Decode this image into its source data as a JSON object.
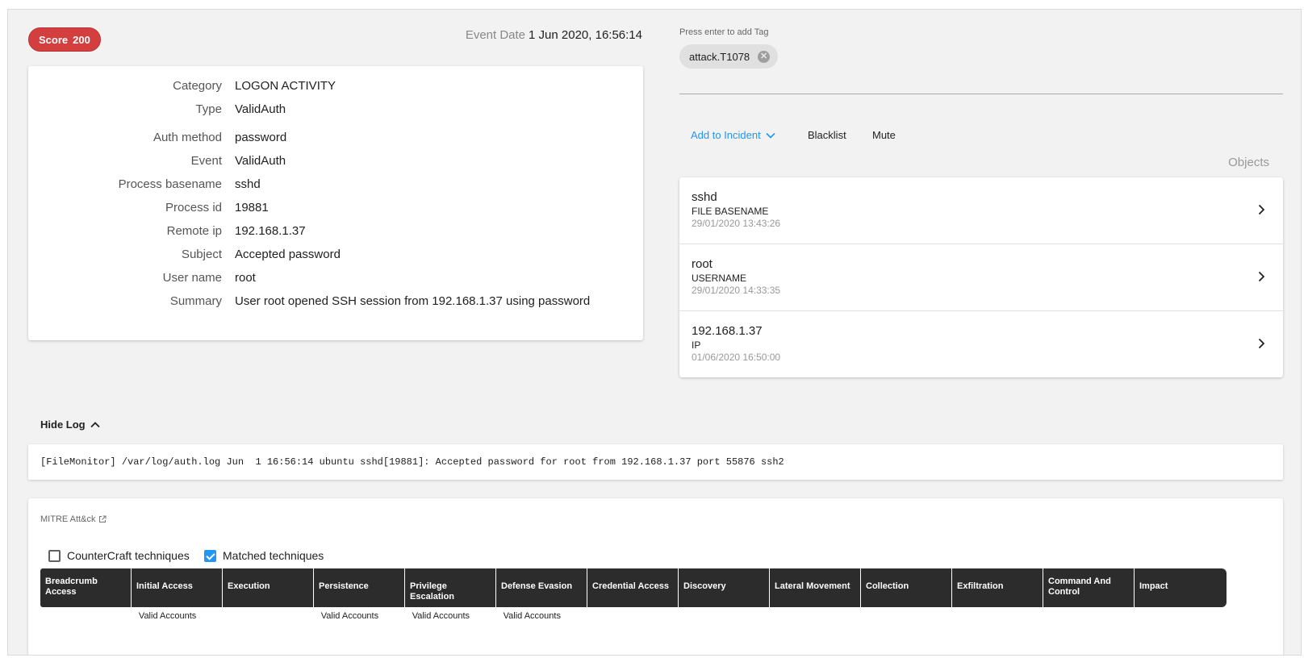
{
  "score": {
    "label": "Score",
    "value": "200"
  },
  "event_date": {
    "label": "Event Date",
    "value": "1 Jun 2020, 16:56:14"
  },
  "details": [
    {
      "key": "Category",
      "value": "LOGON ACTIVITY"
    },
    {
      "key": "Type",
      "value": "ValidAuth"
    },
    {
      "key": "Auth method",
      "value": "password"
    },
    {
      "key": "Event",
      "value": "ValidAuth"
    },
    {
      "key": "Process basename",
      "value": "sshd"
    },
    {
      "key": "Process id",
      "value": "19881"
    },
    {
      "key": "Remote ip",
      "value": "192.168.1.37"
    },
    {
      "key": "Subject",
      "value": "Accepted password"
    },
    {
      "key": "User name",
      "value": "root"
    },
    {
      "key": "Summary",
      "value": "User root opened SSH session from 192.168.1.37 using password"
    }
  ],
  "tags": {
    "hint": "Press enter to add Tag",
    "items": [
      {
        "label": "attack.T1078"
      }
    ]
  },
  "actions": {
    "add_to_incident": "Add to Incident",
    "blacklist": "Blacklist",
    "mute": "Mute"
  },
  "objects": {
    "label": "Objects",
    "items": [
      {
        "name": "sshd",
        "type": "FILE BASENAME",
        "date": "29/01/2020 13:43:26"
      },
      {
        "name": "root",
        "type": "USERNAME",
        "date": "29/01/2020 14:33:35"
      },
      {
        "name": "192.168.1.37",
        "type": "IP",
        "date": "01/06/2020 16:50:00"
      }
    ]
  },
  "log": {
    "toggle_label": "Hide Log",
    "text": "[FileMonitor] /var/log/auth.log Jun  1 16:56:14 ubuntu sshd[19881]: Accepted password for root from 192.168.1.37 port 55876 ssh2"
  },
  "mitre": {
    "title": "MITRE Att&ck",
    "checkboxes": [
      {
        "label": "CounterCraft techniques",
        "checked": false
      },
      {
        "label": "Matched techniques",
        "checked": true
      }
    ],
    "tactics": [
      {
        "name": "Breadcrumb Access",
        "technique": ""
      },
      {
        "name": "Initial Access",
        "technique": "Valid Accounts"
      },
      {
        "name": "Execution",
        "technique": ""
      },
      {
        "name": "Persistence",
        "technique": "Valid Accounts"
      },
      {
        "name": "Privilege Escalation",
        "technique": "Valid Accounts"
      },
      {
        "name": "Defense Evasion",
        "technique": "Valid Accounts"
      },
      {
        "name": "Credential Access",
        "technique": ""
      },
      {
        "name": "Discovery",
        "technique": ""
      },
      {
        "name": "Lateral Movement",
        "technique": ""
      },
      {
        "name": "Collection",
        "technique": ""
      },
      {
        "name": "Exfiltration",
        "technique": ""
      },
      {
        "name": "Command And Control",
        "technique": ""
      },
      {
        "name": "Impact",
        "technique": ""
      }
    ]
  }
}
